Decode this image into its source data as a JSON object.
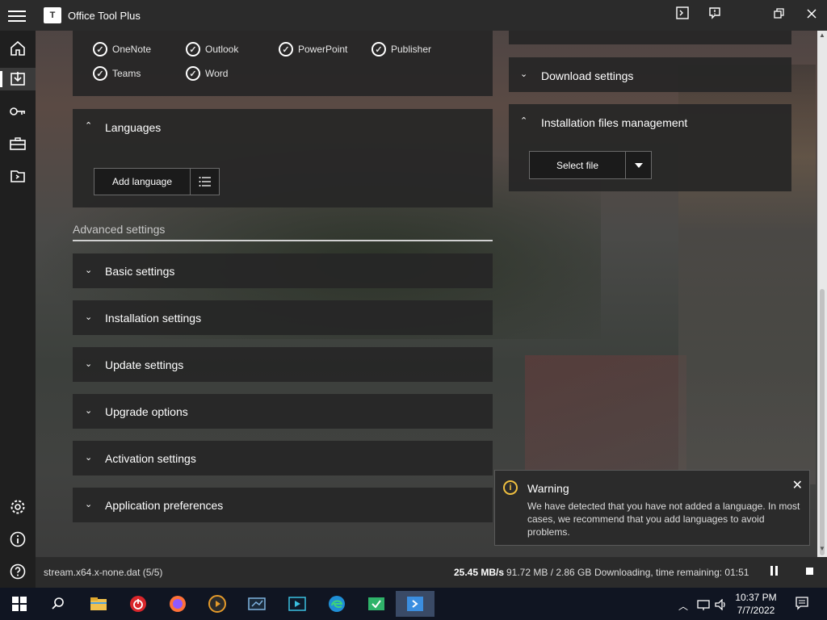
{
  "window": {
    "title": "Office Tool Plus",
    "logo_text": "T"
  },
  "products": [
    "OneNote",
    "Outlook",
    "PowerPoint",
    "Publisher",
    "Teams",
    "Word"
  ],
  "languages": {
    "header": "Languages",
    "add_button": "Add language"
  },
  "advanced": {
    "label": "Advanced settings",
    "sections": [
      "Basic settings",
      "Installation settings",
      "Update settings",
      "Upgrade options",
      "Activation settings",
      "Application preferences"
    ]
  },
  "right_panel": {
    "download_settings": "Download settings",
    "installation_files": "Installation files management",
    "select_file": "Select file"
  },
  "toast": {
    "title": "Warning",
    "message": "We have detected that you have not added a language. In most cases, we recommend that you add languages to avoid problems."
  },
  "status": {
    "file": "stream.x64.x-none.dat (5/5)",
    "speed": "25.45 MB/s",
    "size": "91.72 MB / 2.86 GB",
    "state": "Downloading, time remaining: 01:51"
  },
  "taskbar": {
    "time": "10:37 PM",
    "date": "7/7/2022"
  }
}
